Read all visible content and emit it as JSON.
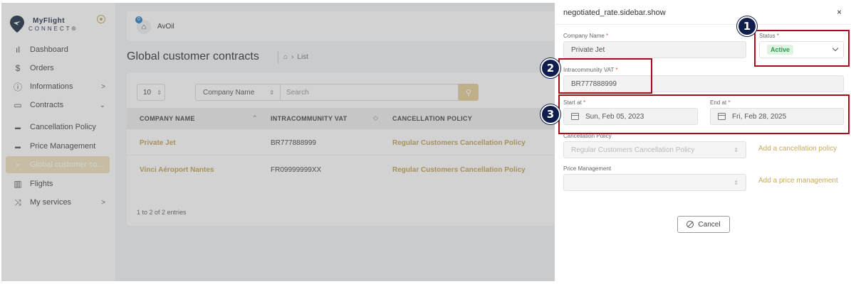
{
  "brand": {
    "name_line1": "MyFlight",
    "name_line2": "CONNECT",
    "mark": "®"
  },
  "sidebar": {
    "items": [
      {
        "label": "Dashboard",
        "icon": "bar-chart-icon"
      },
      {
        "label": "Orders",
        "icon": "dollar-icon"
      },
      {
        "label": "Informations",
        "icon": "info-icon",
        "chevron": ">"
      },
      {
        "label": "Contracts",
        "icon": "folder-icon",
        "chevron": "⌄"
      },
      {
        "label": "Cancellation Policy",
        "icon": "list-icon"
      },
      {
        "label": "Price Management",
        "icon": "list-icon"
      },
      {
        "label": "Global customer co...",
        "icon": "list-icon",
        "active": true
      },
      {
        "label": "Flights",
        "icon": "luggage-icon"
      },
      {
        "label": "My services",
        "icon": "shuffle-icon",
        "chevron": ">"
      }
    ]
  },
  "header": {
    "company_name": "AvOil",
    "badge_count": "0"
  },
  "page": {
    "title": "Global customer contracts",
    "breadcrumb": "List"
  },
  "table": {
    "page_size": "10",
    "filter_field": "Company Name",
    "search_placeholder": "Search",
    "columns": [
      "COMPANY NAME",
      "INTRACOMMUNITY VAT",
      "CANCELLATION POLICY"
    ],
    "rows": [
      {
        "company": "Private Jet",
        "vat": "BR777888999",
        "policy": "Regular Customers Cancellation Policy"
      },
      {
        "company": "Vinci Aéroport Nantes",
        "vat": "FR09999999XX",
        "policy": "Regular Customers Cancellation Policy"
      }
    ],
    "entries": "1 to 2 of 2 entries"
  },
  "panel": {
    "title": "negotiated_rate.sidebar.show",
    "close": "×",
    "company_name_label": "Company Name",
    "company_name": "Private Jet",
    "status_label": "Status",
    "status_value": "Active",
    "vat_label": "Intracommunity VAT",
    "vat_value": "BR777888999",
    "start_label": "Start at",
    "start_value": "Sun, Feb 05, 2023",
    "end_label": "End at",
    "end_value": "Fri, Feb 28, 2025",
    "cancel_policy_label": "Cancellation Policy",
    "cancel_policy_value": "Regular Customers Cancellation Policy",
    "add_cancel_policy": "Add a cancellation policy",
    "price_mgmt_label": "Price Management",
    "add_price_mgmt": "Add a price management",
    "cancel_button": "Cancel",
    "required_mark": "*"
  },
  "annotations": {
    "marker1": "1",
    "marker2": "2",
    "marker3": "3",
    "color": "#a50d1a"
  }
}
